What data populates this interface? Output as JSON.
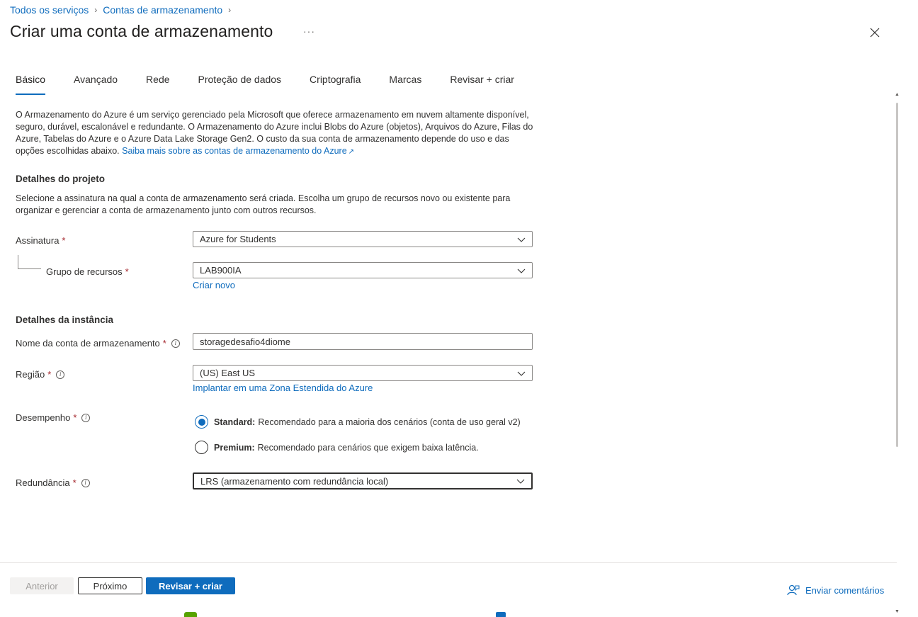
{
  "breadcrumb": {
    "items": [
      "Todos os serviços",
      "Contas de armazenamento"
    ]
  },
  "header": {
    "title": "Criar uma conta de armazenamento",
    "more": "···"
  },
  "tabs": [
    "Básico",
    "Avançado",
    "Rede",
    "Proteção de dados",
    "Criptografia",
    "Marcas",
    "Revisar + criar"
  ],
  "intro": {
    "text": "O Armazenamento do Azure é um serviço gerenciado pela Microsoft que oferece armazenamento em nuvem altamente disponível, seguro, durável, escalonável e redundante. O Armazenamento do Azure inclui Blobs do Azure (objetos), Arquivos do Azure, Filas do Azure, Tabelas do Azure e o Azure Data Lake Storage Gen2. O custo da sua conta de armazenamento depende do uso e das opções escolhidas abaixo.",
    "link": "Saiba mais sobre as contas de armazenamento do Azure"
  },
  "project": {
    "title": "Detalhes do projeto",
    "description": "Selecione a assinatura na qual a conta de armazenamento será criada. Escolha um grupo de recursos novo ou existente para organizar e gerenciar a conta de armazenamento junto com outros recursos.",
    "subscription_label": "Assinatura",
    "subscription_value": "Azure for Students",
    "resource_group_label": "Grupo de recursos",
    "resource_group_value": "LAB900IA",
    "create_new": "Criar novo"
  },
  "instance": {
    "title": "Detalhes da instância",
    "name_label": "Nome da conta de armazenamento",
    "name_value": "storagedesafio4diome",
    "region_label": "Região",
    "region_value": "(US) East US",
    "edge_zone_link": "Implantar em uma Zona Estendida do Azure",
    "performance_label": "Desempenho",
    "standard_bold": "Standard:",
    "standard_text": "Recomendado para a maioria dos cenários (conta de uso geral v2)",
    "premium_bold": "Premium:",
    "premium_text": "Recomendado para cenários que exigem baixa latência.",
    "redundancy_label": "Redundância",
    "redundancy_value": "LRS (armazenamento com redundância local)"
  },
  "required_mark": "*",
  "footer": {
    "prev": "Anterior",
    "next": "Próximo",
    "review": "Revisar + criar",
    "feedback": "Enviar comentários"
  },
  "colors": {
    "accent": "#0f6cbd",
    "required": "#a4262c"
  }
}
